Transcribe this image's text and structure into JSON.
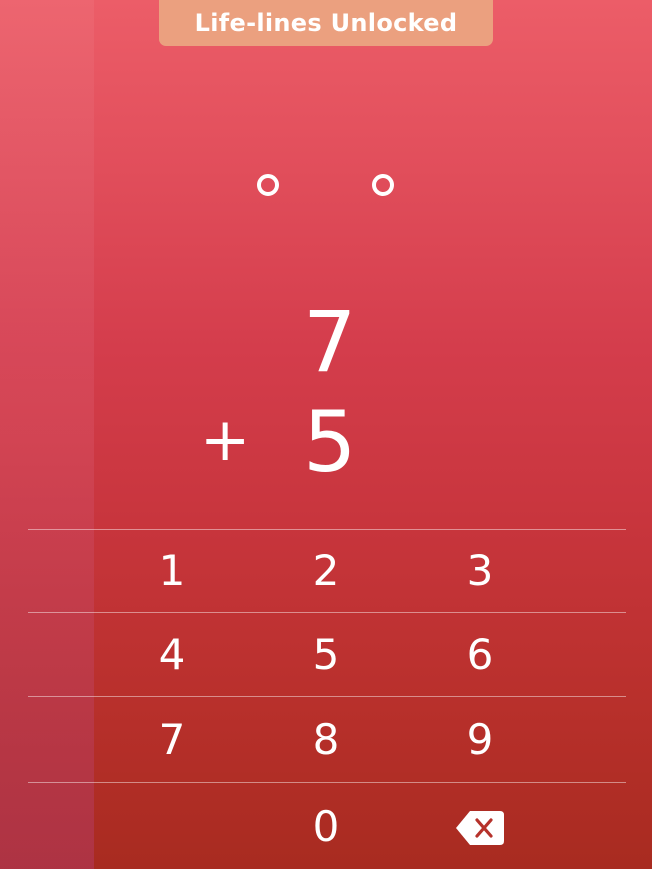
{
  "banner": {
    "label": "Life-lines Unlocked"
  },
  "progress_dots": [
    {
      "name": "progress-dot-1",
      "filled": false
    },
    {
      "name": "progress-dot-2",
      "filled": false
    }
  ],
  "problem": {
    "top_operand": "7",
    "operator": "+",
    "bottom_operand": "5"
  },
  "keypad": {
    "keys": [
      "1",
      "2",
      "3",
      "4",
      "5",
      "6",
      "7",
      "8",
      "9",
      "0"
    ],
    "backspace_icon": "backspace-icon"
  },
  "colors": {
    "background_top": "#ec5d68",
    "background_bottom": "#a82b20",
    "banner": "#eba07f",
    "text": "#ffffff"
  }
}
